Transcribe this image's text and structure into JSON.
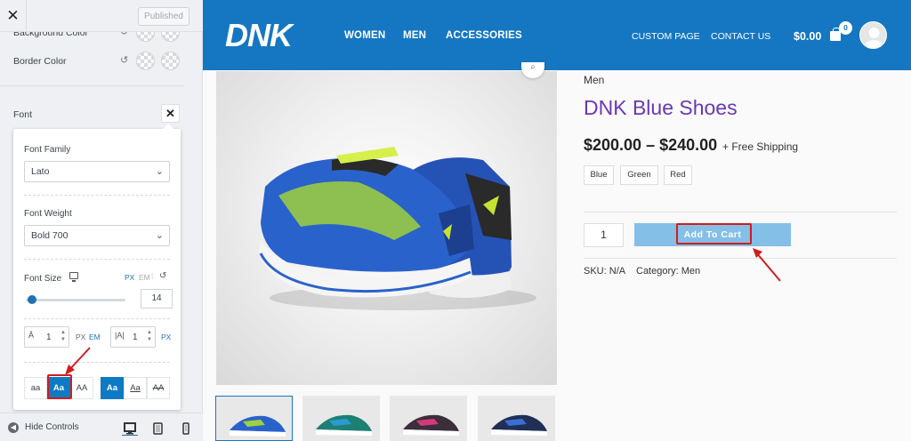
{
  "customizer": {
    "close_icon": "close-icon",
    "publish_label": "Published",
    "color_rows": [
      {
        "label": "Background Color"
      },
      {
        "label": "Border Color"
      }
    ],
    "font_label": "Font",
    "font_family": {
      "label": "Font Family",
      "value": "Lato"
    },
    "font_weight": {
      "label": "Font Weight",
      "value": "Bold 700"
    },
    "font_size": {
      "label": "Font Size",
      "unit_px": "PX",
      "unit_em": "EM",
      "separator": "|",
      "value": "14",
      "slider_fraction": 0.05
    },
    "line_height": {
      "value": "1",
      "unit_px": "PX",
      "unit_em": "EM"
    },
    "letter_spacing": {
      "value": "1",
      "unit_px": "PX"
    },
    "text_transform": [
      "aa",
      "Aa",
      "AA"
    ],
    "text_decoration": [
      "Aa",
      "Aa",
      "AA"
    ],
    "hide_controls": "Hide Controls",
    "devices": [
      "desktop-icon",
      "tablet-icon",
      "mobile-icon"
    ]
  },
  "site": {
    "logo": "DNK",
    "nav_main": [
      "WOMEN",
      "MEN",
      "ACCESSORIES"
    ],
    "nav_secondary": [
      "CUSTOM PAGE",
      "CONTACT US"
    ],
    "cart_total": "$0.00",
    "cart_count": "0",
    "brand_color": "#1577c2"
  },
  "product": {
    "category_crumb": "Men",
    "title": "DNK Blue Shoes",
    "price": "$200.00 – $240.00",
    "shipping": "+ Free Shipping",
    "variations": [
      "Blue",
      "Green",
      "Red"
    ],
    "quantity": "1",
    "add_to_cart": "Add To Cart",
    "sku_label": "SKU:",
    "sku_value": "N/A",
    "category_label": "Category:",
    "category_value": "Men",
    "title_color": "#6a38b0",
    "button_color": "#84bfe7"
  }
}
